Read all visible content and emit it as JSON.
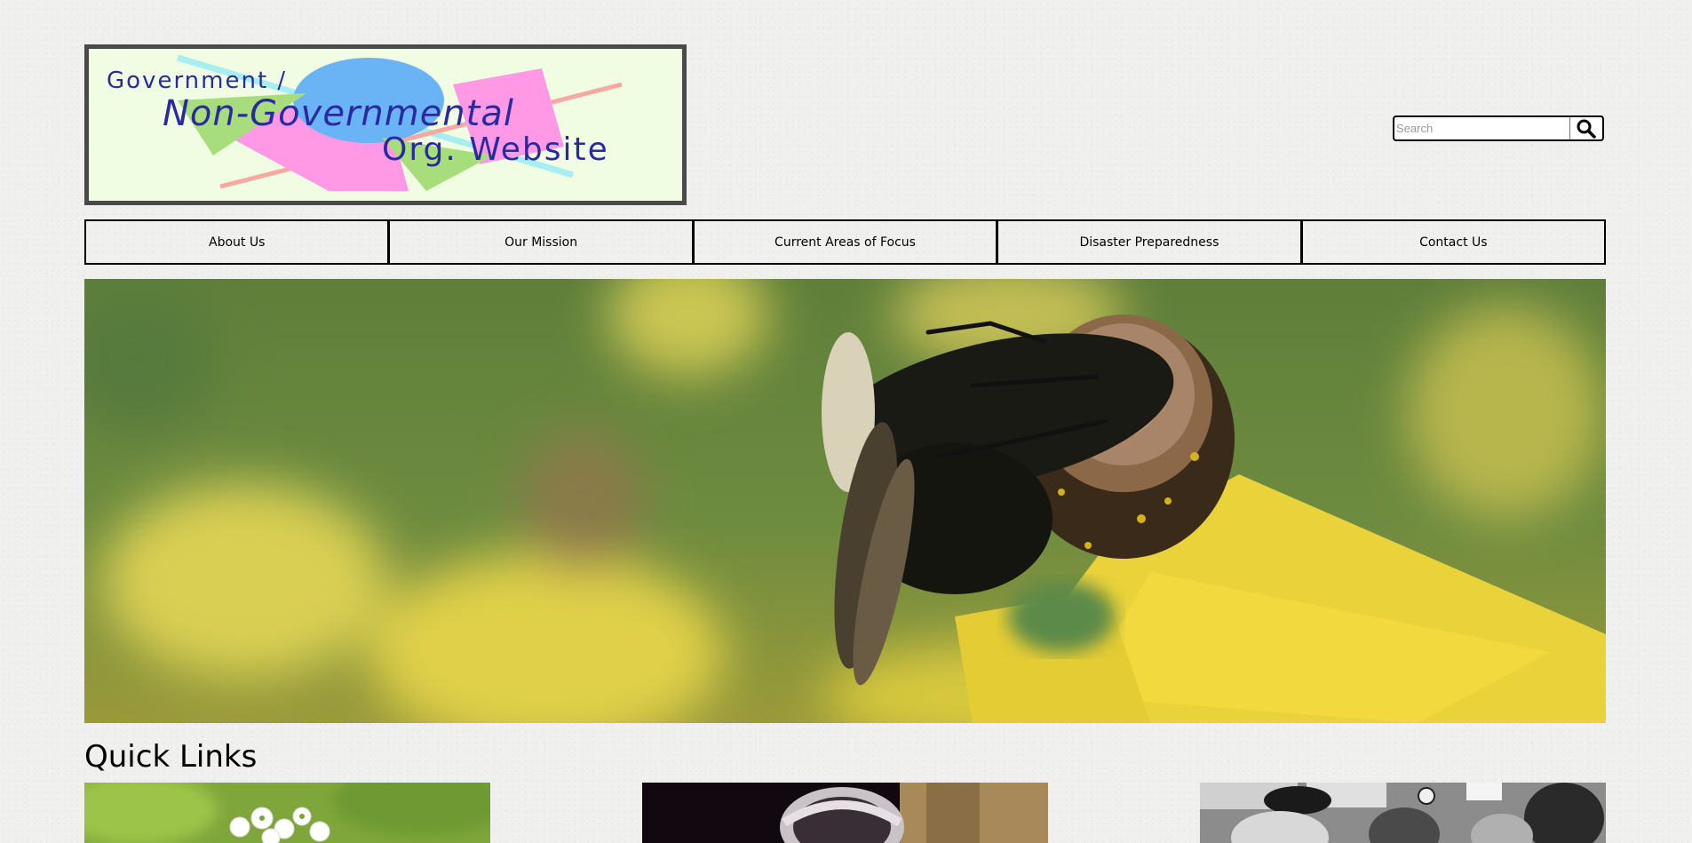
{
  "logo": {
    "line1": "Government /",
    "line2": "Non-Governmental",
    "line3": "Org. Website",
    "colors": {
      "background": "#f1fde3",
      "frame": "#4a4a4a",
      "text": "#2a2aa0",
      "pink": "#ff99e6",
      "blue": "#6ab4f6",
      "green": "#a8dd7c",
      "cyan": "#a7eef0",
      "salmon": "#f9a7a0"
    }
  },
  "search": {
    "placeholder": "Search",
    "icon": "search-icon"
  },
  "nav": {
    "items": [
      {
        "label": "About Us"
      },
      {
        "label": "Our Mission"
      },
      {
        "label": "Current Areas of Focus"
      },
      {
        "label": "Disaster Preparedness"
      },
      {
        "label": "Contact Us"
      }
    ]
  },
  "hero": {
    "subject": "bumblebee on yellow coneflower"
  },
  "quick_links": {
    "title": "Quick Links",
    "cards": [
      {
        "subject": "white flowers with green foliage"
      },
      {
        "subject": "person in a helmet, dark background"
      },
      {
        "subject": "black and white crowd at a protest"
      }
    ]
  }
}
